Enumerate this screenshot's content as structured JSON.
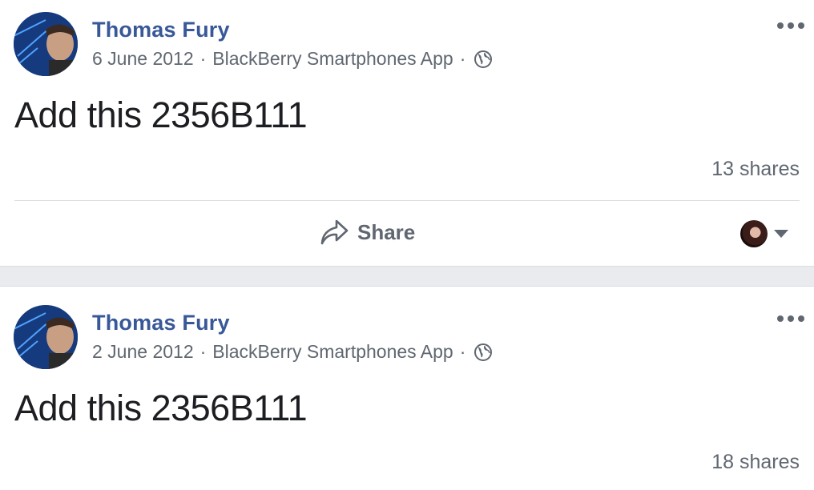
{
  "posts": [
    {
      "author": "Thomas Fury",
      "date": "6 June 2012",
      "separator": "·",
      "app": "BlackBerry Smartphones App",
      "privacy_icon": "globe-icon",
      "text": "Add this 2356B111",
      "shares": "13 shares",
      "share_label": "Share"
    },
    {
      "author": "Thomas Fury",
      "date": "2 June 2012",
      "separator": "·",
      "app": "BlackBerry Smartphones App",
      "privacy_icon": "globe-icon",
      "text": "Add this 2356B111",
      "shares": "18 shares"
    }
  ],
  "colors": {
    "author": "#385898",
    "secondary_text": "#606770",
    "feed_gap": "#e9ebee"
  }
}
